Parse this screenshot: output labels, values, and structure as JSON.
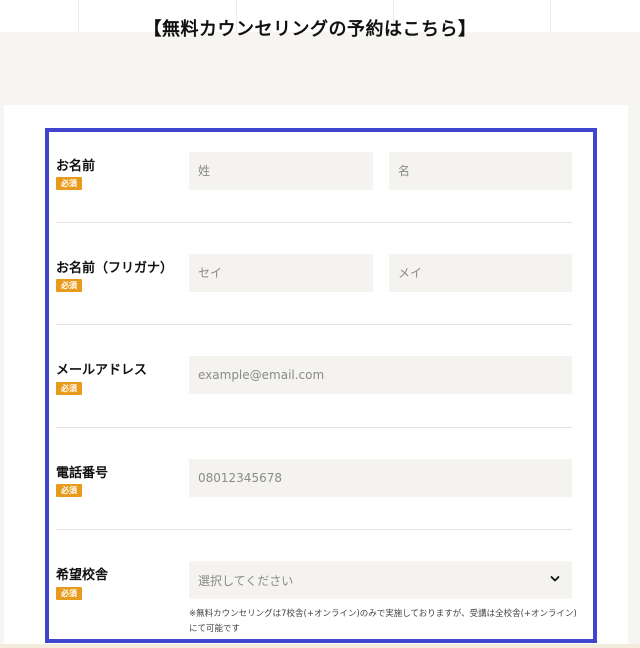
{
  "page": {
    "title": "【無料カウンセリングの予約はこちら】"
  },
  "form": {
    "required_label": "必須",
    "rows": [
      {
        "label": "お名前",
        "fields": [
          {
            "placeholder": "姓",
            "value": ""
          },
          {
            "placeholder": "名",
            "value": ""
          }
        ]
      },
      {
        "label": "お名前（フリガナ）",
        "fields": [
          {
            "placeholder": "セイ",
            "value": ""
          },
          {
            "placeholder": "メイ",
            "value": ""
          }
        ]
      },
      {
        "label": "メールアドレス",
        "fields": [
          {
            "placeholder": "example@email.com",
            "value": ""
          }
        ]
      },
      {
        "label": "電話番号",
        "fields": [
          {
            "placeholder": "08012345678",
            "value": ""
          }
        ]
      },
      {
        "label": "希望校舎",
        "select": {
          "selected": "選択してください"
        },
        "note": "※無料カウンセリングは7校舎(+オンライン)のみで実施しておりますが、受講は全校舎(+オンライン)にて可能です"
      }
    ]
  },
  "colors": {
    "frame_border": "#3f45cc",
    "required_badge": "#e89a1c",
    "field_background": "#f4f3f0",
    "page_background": "#f6f5f1"
  },
  "icons": {
    "select_arrow": "chevron-down-icon"
  }
}
